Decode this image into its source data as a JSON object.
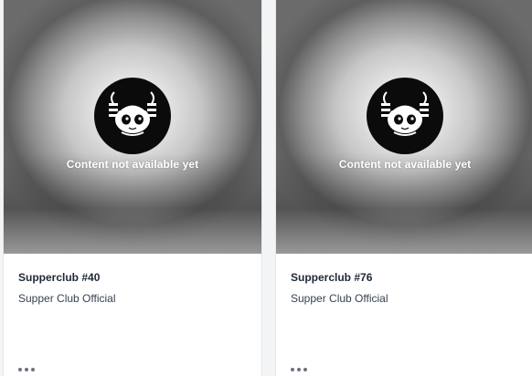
{
  "cards": [
    {
      "title": "Supperclub #40",
      "collection": "Supper Club Official",
      "status": "Content not available yet",
      "more_icon": "ellipsis-icon"
    },
    {
      "title": "Supperclub #76",
      "collection": "Supper Club Official",
      "status": "Content not available yet",
      "more_icon": "ellipsis-icon"
    }
  ],
  "colors": {
    "card_background": "#ffffff",
    "page_background": "#f3f4f6",
    "title_text": "#1f2937",
    "avatar_background": "#0b0b0b"
  }
}
